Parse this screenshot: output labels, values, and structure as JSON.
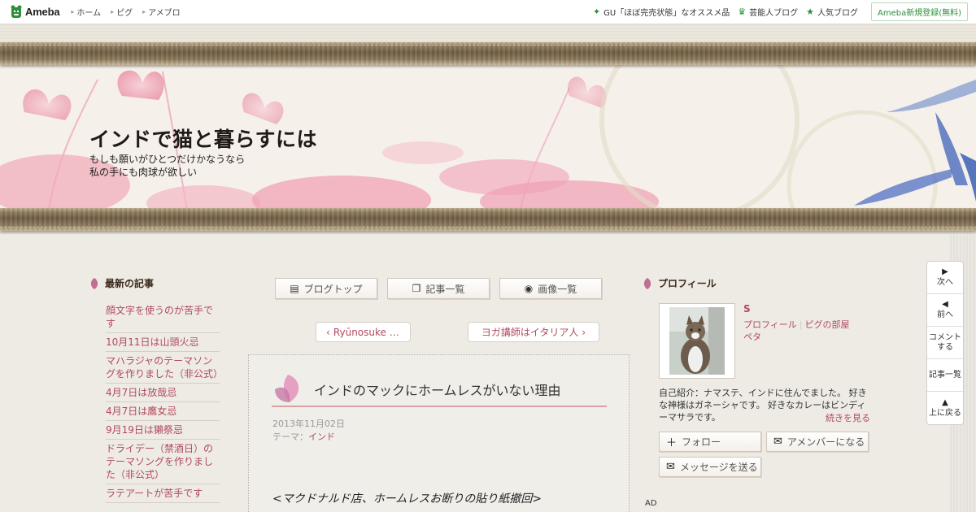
{
  "topbar": {
    "logo": "Ameba",
    "links": [
      "ホーム",
      "ピグ",
      "アメブロ"
    ],
    "right_items": [
      {
        "icon": "sparkle-icon",
        "label": "GU「ほぼ完売状態」なオススメ品"
      },
      {
        "icon": "crown-icon",
        "label": "芸能人ブログ"
      },
      {
        "icon": "star-icon",
        "label": "人気ブログ"
      }
    ],
    "register": "Ameba新規登録(無料)"
  },
  "header": {
    "title": "インドで猫と暮らすには",
    "description_line1": "もしも願いがひとつだけかなうなら",
    "description_line2": "私の手にも肉球が欲しい"
  },
  "sidebar": {
    "title": "最新の記事",
    "items": [
      "顔文字を使うのが苦手です",
      "10月11日は山頭火忌",
      "マハラジャのテーマソングを作りました（非公式）",
      "4月7日は放哉忌",
      "4月7日は鷹女忌",
      "9月19日は獺祭忌",
      "ドライデー（禁酒日）のテーマソングを作りました（非公式）",
      "ラテアートが苦手です"
    ]
  },
  "nav": {
    "blog_top": "ブログトップ",
    "entry_list": "記事一覧",
    "image_list": "画像一覧"
  },
  "pager": {
    "prev": "Ryūnosuke …",
    "next": "ヨガ講師はイタリア人"
  },
  "article": {
    "title": "インドのマックにホームレスがいない理由",
    "date": "2013年11月02日",
    "theme_label": "テーマ：",
    "theme": "インド",
    "body_first_line": "<マクドナルド店、ホームレスお断りの貼り紙撤回>"
  },
  "profile": {
    "title": "プロフィール",
    "name": "S",
    "link_profile": "プロフィール",
    "link_pig_room": "ピグの部屋",
    "link_peta": "ペタ",
    "intro": "自己紹介：ナマステ、インドに住んでました。 好きな神様はガネーシャです。 好きなカレーはビンディーマサラです。",
    "more": "続きを見る",
    "follow": "フォロー",
    "amember": "アメンバーになる",
    "message": "メッセージを送る"
  },
  "ad_label": "AD",
  "side_nav": {
    "next": "次へ",
    "prev": "前へ",
    "comment_line1": "コメント",
    "comment_line2": "する",
    "entry_list": "記事一覧",
    "top_line1": "上に戻る"
  },
  "colors": {
    "link": "#b14a5c",
    "ameba_green": "#2d8f3c",
    "background": "#eeebe5"
  }
}
